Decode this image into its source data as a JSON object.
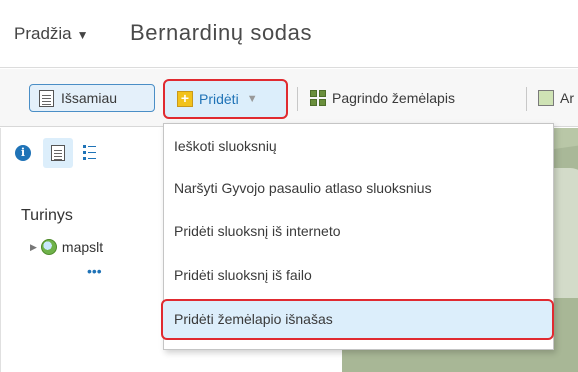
{
  "header": {
    "home_label": "Pradžia",
    "home_caret": "▼",
    "title": "Bernardinų sodas"
  },
  "toolbar": {
    "details_label": "Išsamiau",
    "add_label": "Pridėti",
    "add_caret": "▼",
    "basemap_label": "Pagrindo žemėlapis",
    "analysis_label": "Ar"
  },
  "panel": {
    "info_icon": "i",
    "contents_heading": "Turinys",
    "layer_expand": "▶",
    "layer_name": "mapslt",
    "layer_more": "•••"
  },
  "add_menu": {
    "items": [
      "Ieškoti sluoksnių",
      "Naršyti Gyvojo pasaulio atlaso sluoksnius",
      "Pridėti sluoksnį iš interneto",
      "Pridėti sluoksnį iš failo",
      "Pridėti žemėlapio išnašas"
    ]
  },
  "colors": {
    "accent": "#1f73b7",
    "highlight_border": "#e02a30",
    "selected_bg": "#dceefb"
  }
}
